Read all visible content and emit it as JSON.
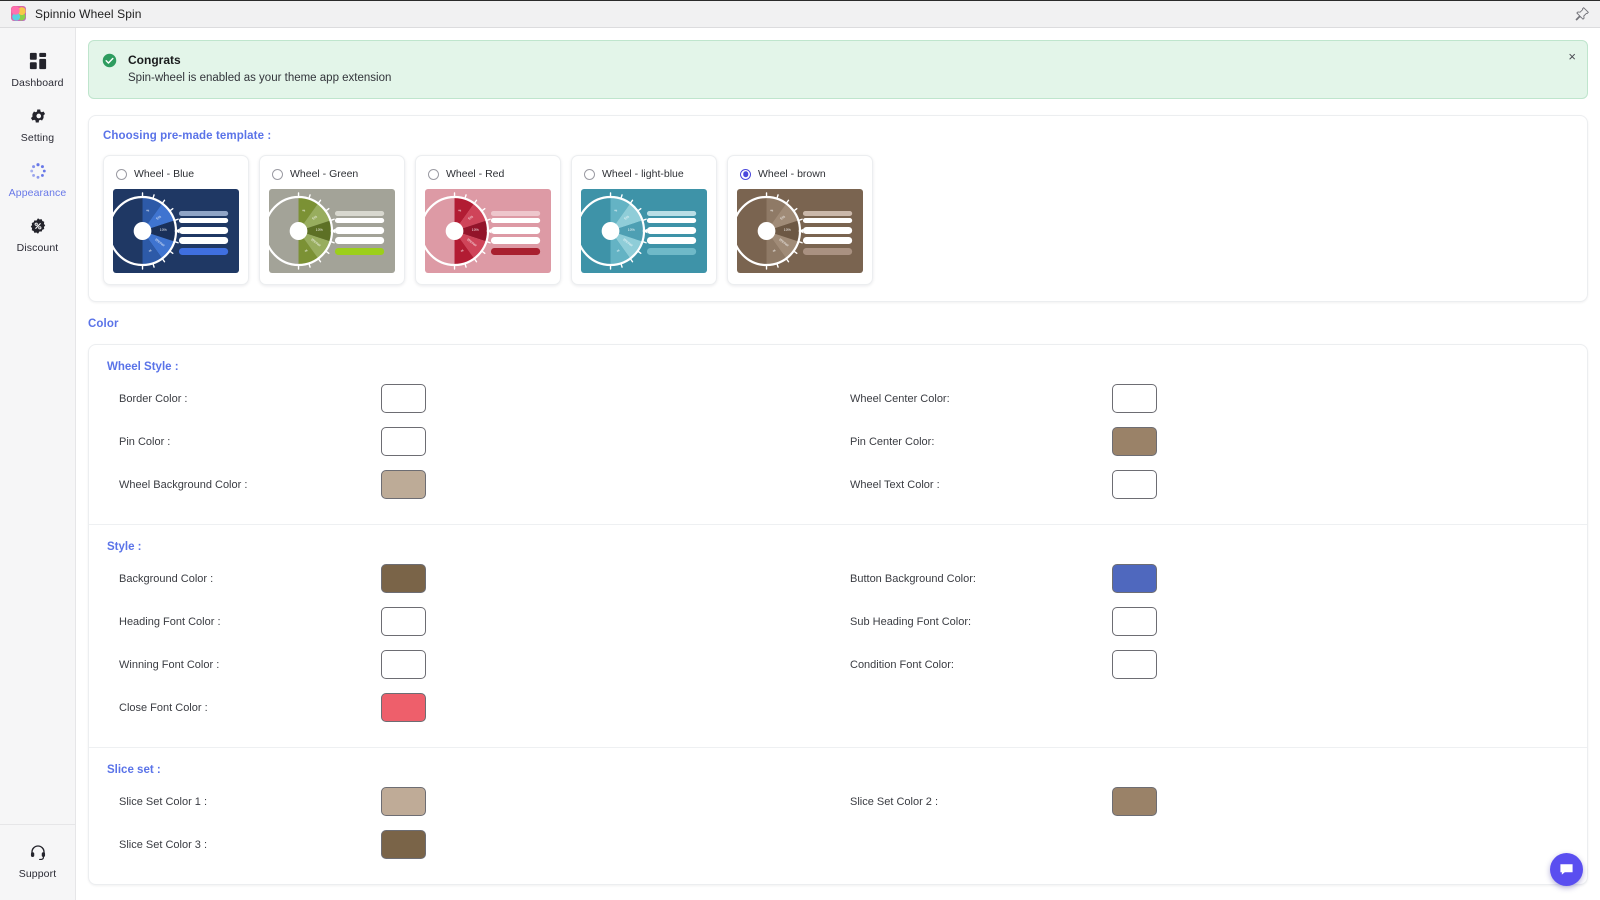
{
  "window": {
    "title": "Spinnio Wheel Spin",
    "app_icon": "spinnio-logo-icon",
    "pin_icon": "pin-icon"
  },
  "sidebar": {
    "items": [
      {
        "label": "Dashboard",
        "icon": "dashboard-grid-icon",
        "active": false
      },
      {
        "label": "Setting",
        "icon": "gear-icon",
        "active": false
      },
      {
        "label": "Appearance",
        "icon": "spinner-dots-icon",
        "active": true
      },
      {
        "label": "Discount",
        "icon": "discount-badge-icon",
        "active": false
      }
    ],
    "bottom": {
      "label": "Support",
      "icon": "headset-icon"
    }
  },
  "banner": {
    "icon": "success-check-icon",
    "title": "Congrats",
    "subtitle": "Spin-wheel is enabled as your theme app extension",
    "close_label": "×",
    "background": "#e3f5e9",
    "border": "#bfe5cd"
  },
  "templates": {
    "heading": "Choosing pre-made template :",
    "items": [
      {
        "label": "Wheel - Blue",
        "selected": false,
        "bg": "#1f3864",
        "slice_a": "#2d5aa8",
        "slice_b": "#3f74d0",
        "slice_c": "#1a3059",
        "bar_main": "#ffffff",
        "bar_accent": "#3f6fe0",
        "bar_faint": "#8fa4c6"
      },
      {
        "label": "Wheel - Green",
        "selected": false,
        "bg": "#a3a398",
        "slice_a": "#7b9134",
        "slice_b": "#98ad5e",
        "slice_c": "#5d7025",
        "bar_main": "#ffffff",
        "bar_accent": "#9ccf1b",
        "bar_faint": "#d8d8cf"
      },
      {
        "label": "Wheel - Red",
        "selected": false,
        "bg": "#dd9aa5",
        "slice_a": "#b21c33",
        "slice_b": "#cf4459",
        "slice_c": "#93142a",
        "bar_main": "#ffffff",
        "bar_accent": "#a8202f",
        "bar_faint": "#eec6cc"
      },
      {
        "label": "Wheel - light-blue",
        "selected": false,
        "bg": "#3e93a8",
        "slice_a": "#64b3c4",
        "slice_b": "#8fcdd8",
        "slice_c": "#4e9fb3",
        "bar_main": "#ffffff",
        "bar_accent": "#6fb9c8",
        "bar_faint": "#b9dee6"
      },
      {
        "label": "Wheel - brown",
        "selected": true,
        "bg": "#7a6450",
        "slice_a": "#8f7a66",
        "slice_b": "#a08b77",
        "slice_c": "#6d5844",
        "bar_main": "#ffffff",
        "bar_accent": "#a99181",
        "bar_faint": "#cbb8aa"
      }
    ]
  },
  "color_section": {
    "heading": "Color",
    "groups": [
      {
        "title": "Wheel Style :",
        "fields": [
          {
            "label": "Border Color :",
            "value": "#ffffff"
          },
          {
            "label": "Wheel Center Color:",
            "value": "#ffffff"
          },
          {
            "label": "Pin Color :",
            "value": "#ffffff"
          },
          {
            "label": "Pin Center Color:",
            "value": "#9a8268"
          },
          {
            "label": "Wheel Background Color :",
            "value": "#bdab97"
          },
          {
            "label": "Wheel Text Color :",
            "value": "#ffffff"
          }
        ]
      },
      {
        "title": "Style :",
        "fields": [
          {
            "label": "Background Color :",
            "value": "#7a6448"
          },
          {
            "label": "Button Background Color:",
            "value": "#4f68be"
          },
          {
            "label": "Heading Font Color :",
            "value": "#ffffff"
          },
          {
            "label": "Sub Heading Font Color:",
            "value": "#ffffff"
          },
          {
            "label": "Winning Font Color :",
            "value": "#ffffff"
          },
          {
            "label": "Condition Font Color:",
            "value": "#ffffff"
          },
          {
            "label": "Close Font Color :",
            "value": "#ee5f6b"
          }
        ]
      },
      {
        "title": "Slice set :",
        "fields": [
          {
            "label": "Slice Set Color 1 :",
            "value": "#bfab97"
          },
          {
            "label": "Slice Set Color 2 :",
            "value": "#9a8268"
          },
          {
            "label": "Slice Set Color 3 :",
            "value": "#7a6448"
          }
        ]
      }
    ]
  },
  "chat_widget": {
    "icon": "chat-bubble-icon",
    "color": "#5a4ef0"
  }
}
